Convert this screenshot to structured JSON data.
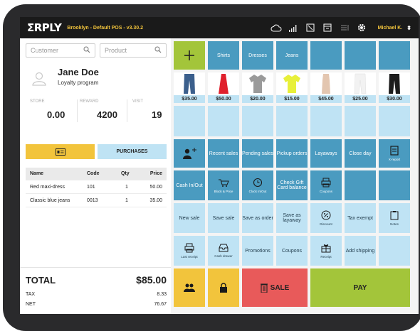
{
  "header": {
    "logo": "ΣRPLY",
    "store_title": "Brooklyn - Default POS - v3.30.2",
    "user": "Michael K.",
    "icons": [
      "cloud-icon",
      "signal-icon",
      "screen-icon",
      "printer-icon",
      "list-icon",
      "gear-icon"
    ]
  },
  "search": {
    "customer_placeholder": "Customer",
    "product_placeholder": "Product"
  },
  "customer": {
    "name": "Jane Doe",
    "program": "Loyalty program"
  },
  "stats": {
    "store_label": "STORE",
    "store_value": "0.00",
    "reward_label": "REWARD",
    "reward_value": "4200",
    "visit_label": "VISIT",
    "visit_value": "19"
  },
  "actions": {
    "purchases_label": "PURCHASES"
  },
  "cart": {
    "headers": {
      "name": "Name",
      "code": "Code",
      "qty": "Qty",
      "price": "Price"
    },
    "rows": [
      {
        "name": "Red maxi-dress",
        "code": "101",
        "qty": "1",
        "price": "50.00"
      },
      {
        "name": "Classic blue jeans",
        "code": "0013",
        "qty": "1",
        "price": "35.00"
      }
    ]
  },
  "totals": {
    "total_label": "TOTAL",
    "total_value": "$85.00",
    "tax_label": "TAX",
    "tax_value": "8.33",
    "net_label": "NET",
    "net_value": "76.67"
  },
  "grid": {
    "row1": [
      "Shirts",
      "Dresses",
      "Jeans"
    ],
    "prices": [
      "$35.00",
      "$50.00",
      "$20.00",
      "$15.00",
      "$45.00",
      "$25.00",
      "$30.00"
    ],
    "row4": {
      "recent": "Recent sales",
      "pending": "Pending sales",
      "pickup": "Pickup orders",
      "layaways": "Layaways",
      "close": "Close day",
      "xreport": "X-report"
    },
    "row5": {
      "cash": "Cash In/Out",
      "block": "Block & Price",
      "clock": "Clock In/Out",
      "giftcard": "Check Gift Card balance",
      "coupons": "Coupons"
    },
    "row6": {
      "newsale": "New sale",
      "savesale": "Save sale",
      "saveorder": "Save as order",
      "savelayaway": "Save as layaway",
      "discount": "Discount",
      "taxexempt": "Tax exempt",
      "notes": "Notes"
    },
    "row7": {
      "lastreceipt": "Last receipt",
      "cashdrawer": "Cash drawer",
      "promotions": "Promotions",
      "coupons": "Coupons",
      "receipt": "Receipt",
      "shipping": "Add shipping"
    },
    "bottom": {
      "sale": "SALE",
      "pay": "PAY"
    }
  },
  "colors": {
    "accent_yellow": "#f2c43c",
    "tile_light": "#bfe3f4",
    "tile_dark": "#4a9bc0",
    "sale_red": "#e85a5a",
    "pay_green": "#a3c53a"
  }
}
